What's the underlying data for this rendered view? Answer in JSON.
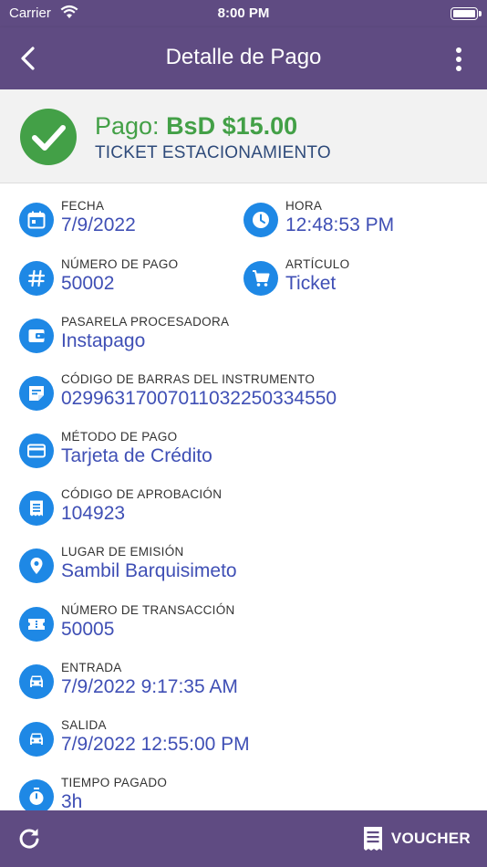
{
  "status_bar": {
    "carrier": "Carrier",
    "time": "8:00 PM"
  },
  "header": {
    "title": "Detalle de Pago"
  },
  "summary": {
    "amount_prefix": "Pago: ",
    "amount": "BsD $15.00",
    "type": "TICKET ESTACIONAMIENTO"
  },
  "fields": {
    "fecha": {
      "label": "FECHA",
      "value": "7/9/2022",
      "icon": "calendar-icon"
    },
    "hora": {
      "label": "HORA",
      "value": "12:48:53 PM",
      "icon": "clock-icon"
    },
    "numero_pago": {
      "label": "NÚMERO DE PAGO",
      "value": "50002",
      "icon": "hash-icon"
    },
    "articulo": {
      "label": "ARTÍCULO",
      "value": "Ticket",
      "icon": "cart-icon"
    },
    "pasarela": {
      "label": "PASARELA PROCESADORA",
      "value": "Instapago",
      "icon": "wallet-icon"
    },
    "codigo_barras": {
      "label": "CÓDIGO DE BARRAS DEL INSTRUMENTO",
      "value": "02996317007011032250334550",
      "icon": "note-icon"
    },
    "metodo_pago": {
      "label": "MÉTODO DE PAGO",
      "value": "Tarjeta de Crédito",
      "icon": "credit-card-icon"
    },
    "codigo_aprobacion": {
      "label": "CÓDIGO DE APROBACIÓN",
      "value": "104923",
      "icon": "receipt-icon"
    },
    "lugar_emision": {
      "label": "LUGAR DE EMISIÓN",
      "value": "Sambil Barquisimeto",
      "icon": "location-pin-icon"
    },
    "numero_transaccion": {
      "label": "NÚMERO DE TRANSACCIÓN",
      "value": "50005",
      "icon": "ticket-icon"
    },
    "entrada": {
      "label": "ENTRADA",
      "value": "7/9/2022 9:17:35 AM",
      "icon": "car-icon"
    },
    "salida": {
      "label": "SALIDA",
      "value": "7/9/2022 12:55:00 PM",
      "icon": "car-icon"
    },
    "tiempo_pagado": {
      "label": "TIEMPO PAGADO",
      "value": "3h",
      "icon": "timer-icon"
    }
  },
  "bottom_bar": {
    "voucher_label": "VOUCHER"
  },
  "colors": {
    "bar": "#5f4b82",
    "accent_blue": "#1e88e5",
    "value_text": "#3f4fb5",
    "success_green": "#43a047"
  }
}
